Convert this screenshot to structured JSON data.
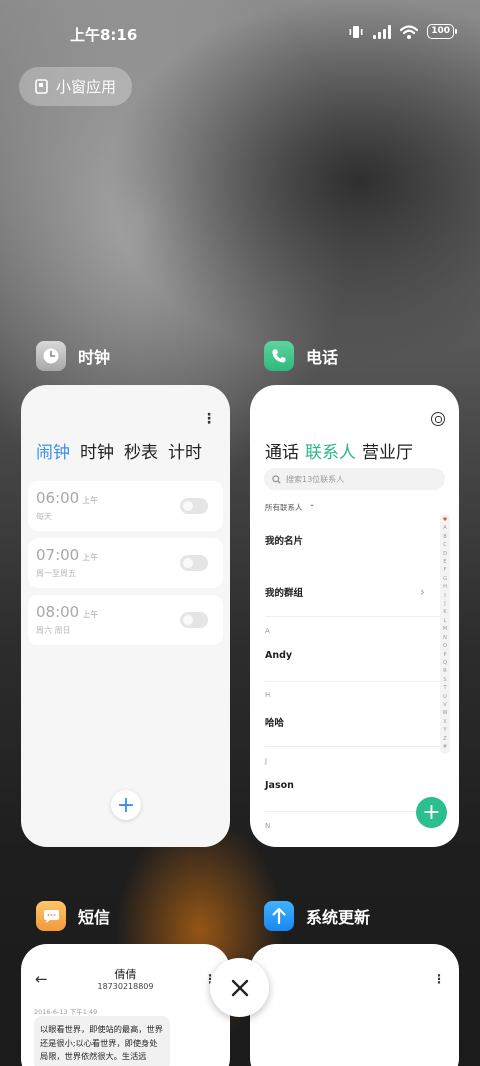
{
  "status_bar": {
    "time": "上午8:16",
    "battery": "100"
  },
  "small_window": {
    "label": "小窗应用"
  },
  "apps": {
    "clock": {
      "name": "时钟",
      "tabs": [
        "闹钟",
        "时钟",
        "秒表",
        "计时"
      ],
      "alarms": [
        {
          "time": "06:00",
          "ampm": "上午",
          "repeat": "每天"
        },
        {
          "time": "07:00",
          "ampm": "上午",
          "repeat": "周一至周五"
        },
        {
          "time": "08:00",
          "ampm": "上午",
          "repeat": "周六 周日"
        }
      ]
    },
    "phone": {
      "name": "电话",
      "tabs": [
        "通话",
        "联系人",
        "营业厅"
      ],
      "search_placeholder": "搜索13位联系人",
      "filter": "所有联系人",
      "my_card": "我的名片",
      "my_groups": "我的群组",
      "sections": [
        {
          "letter": "A",
          "name": "Andy"
        },
        {
          "letter": "H",
          "name": "哈哈"
        },
        {
          "letter": "J",
          "name": "Jason"
        },
        {
          "letter": "N",
          "name": ""
        }
      ],
      "index_letters": [
        "♥",
        "A",
        "B",
        "C",
        "D",
        "E",
        "F",
        "G",
        "H",
        "I",
        "J",
        "K",
        "L",
        "M",
        "N",
        "O",
        "P",
        "Q",
        "R",
        "S",
        "T",
        "U",
        "V",
        "W",
        "X",
        "Y",
        "Z",
        "#"
      ]
    },
    "messages": {
      "name": "短信",
      "contact_name": "倩倩",
      "contact_number": "18730218809",
      "timestamp": "2016-6-13 下午1:49",
      "message": "以眼看世界，即使站的最高，世界还是很小;以心看世界，即使身处局限，世界依然很大。生活远"
    },
    "update": {
      "name": "系统更新"
    }
  },
  "colors": {
    "clock_accent": "#3a8fe8",
    "phone_accent": "#2bb98a"
  }
}
